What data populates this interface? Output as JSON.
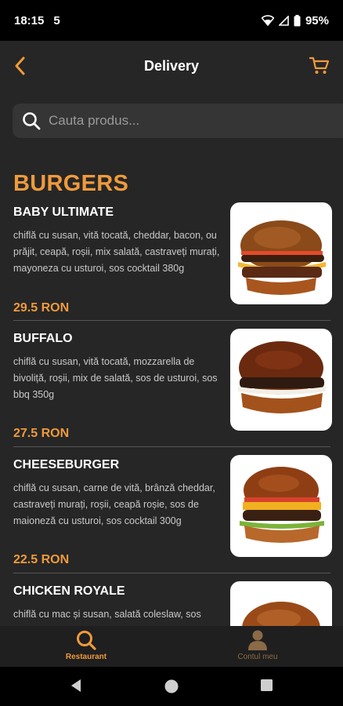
{
  "status_bar": {
    "time": "18:15",
    "carrier_icon": "5",
    "battery": "95%"
  },
  "header": {
    "title": "Delivery"
  },
  "search": {
    "placeholder": "Cauta produs..."
  },
  "category": {
    "title": "BURGERS"
  },
  "products": [
    {
      "name": "BABY ULTIMATE",
      "description": "chiflă cu susan, vită tocată, cheddar, bacon, ou prăjit, ceapă, roșii, mix salată, castraveți murați, mayoneza cu usturoi, sos cocktail 380g",
      "price": "29.5 RON"
    },
    {
      "name": "BUFFALO",
      "description": "chiflă cu susan, vită tocată, mozzarella de bivoliță, roșii, mix de salată, sos de usturoi, sos bbq 350g",
      "price": "27.5 RON"
    },
    {
      "name": "CHEESEBURGER",
      "description": "chiflă cu susan, carne de vită, brânză cheddar, castraveți murați, roșii, ceapă roșie, sos de maioneză cu usturoi, sos cocktail 300g",
      "price": "22.5 RON"
    },
    {
      "name": "CHICKEN ROYALE",
      "description": "chiflă cu mac și susan, salată coleslaw, sos",
      "price": ""
    }
  ],
  "tabbar": {
    "restaurant_label": "Restaurant",
    "account_label": "Contul meu"
  },
  "colors": {
    "accent": "#ef9a3c",
    "background": "#262626",
    "search_bg": "#353535",
    "inactive_tab": "#8a6a47"
  },
  "icons": [
    "back-icon",
    "cart-icon",
    "search-icon",
    "user-icon",
    "wifi-icon",
    "signal-icon",
    "battery-icon"
  ]
}
